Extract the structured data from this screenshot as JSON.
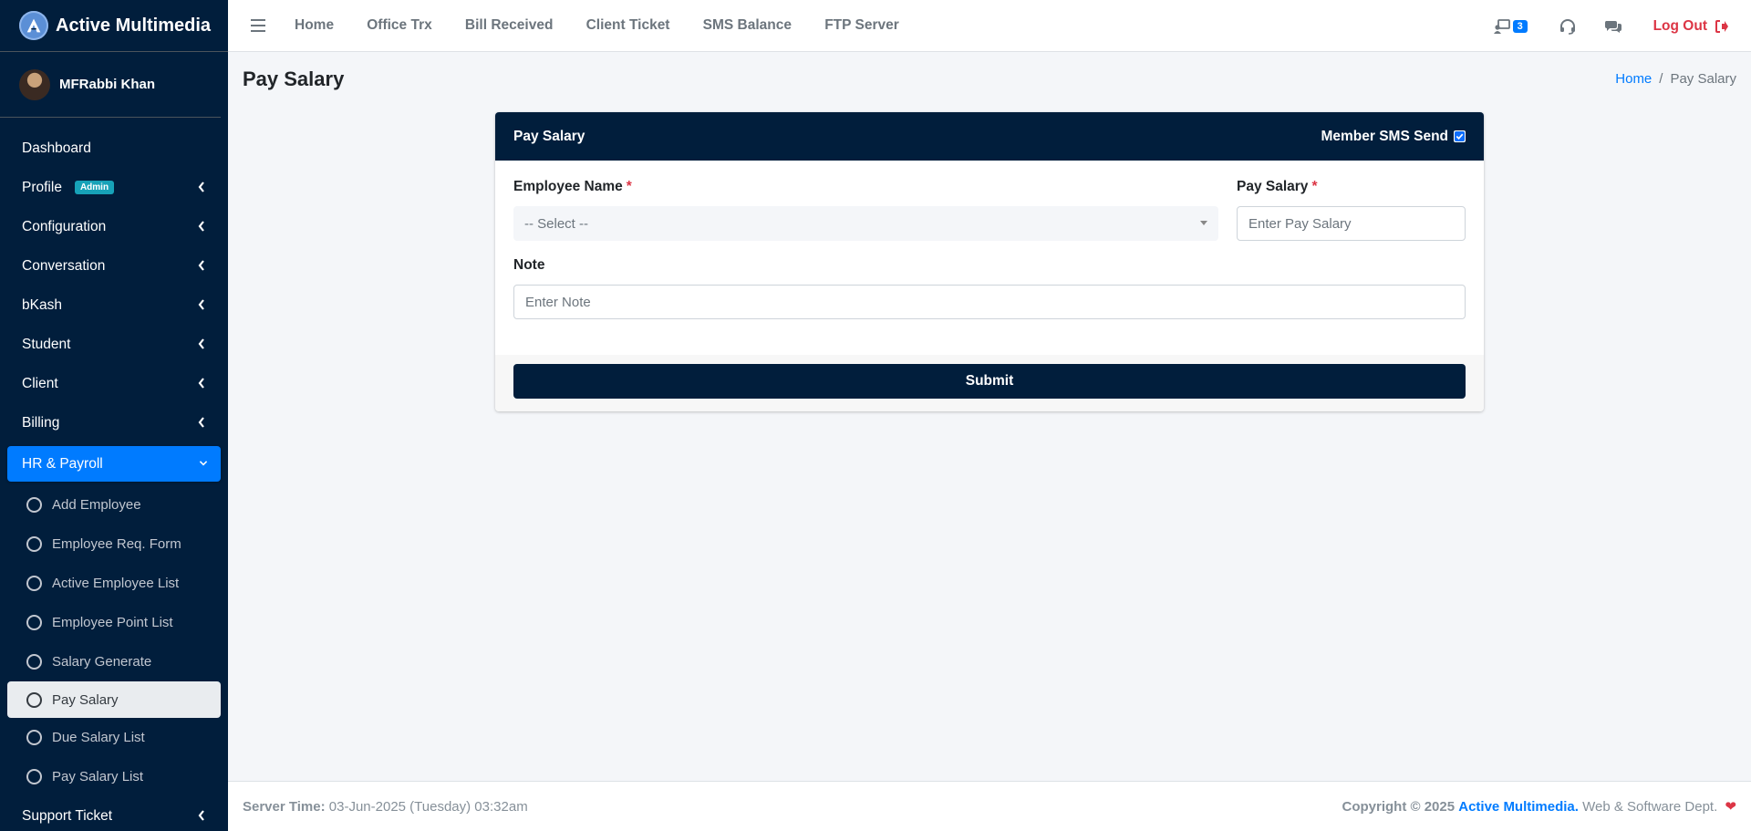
{
  "brand": {
    "name": "Active Multimedia"
  },
  "user": {
    "name": "MFRabbi Khan"
  },
  "sidebar": {
    "items": [
      {
        "label": "Dashboard"
      },
      {
        "label": "Profile",
        "badge": "Admin"
      },
      {
        "label": "Configuration"
      },
      {
        "label": "Conversation"
      },
      {
        "label": "bKash"
      },
      {
        "label": "Student"
      },
      {
        "label": "Client"
      },
      {
        "label": "Billing"
      },
      {
        "label": "HR & Payroll"
      },
      {
        "label": "Support Ticket"
      }
    ],
    "hr_sub": [
      {
        "label": "Add Employee"
      },
      {
        "label": "Employee Req. Form"
      },
      {
        "label": "Active Employee List"
      },
      {
        "label": "Employee Point List"
      },
      {
        "label": "Salary Generate"
      },
      {
        "label": "Pay Salary"
      },
      {
        "label": "Due Salary List"
      },
      {
        "label": "Pay Salary List"
      }
    ]
  },
  "topnav": {
    "links": [
      {
        "label": "Home"
      },
      {
        "label": "Office Trx"
      },
      {
        "label": "Bill Received"
      },
      {
        "label": "Client Ticket"
      },
      {
        "label": "SMS Balance"
      },
      {
        "label": "FTP Server"
      }
    ],
    "notification_count": "3",
    "logout_label": "Log Out"
  },
  "page": {
    "title": "Pay Salary",
    "breadcrumb_home": "Home",
    "breadcrumb_sep": "/",
    "breadcrumb_current": "Pay Salary"
  },
  "form": {
    "card_title": "Pay Salary",
    "sms_label": "Member SMS Send",
    "sms_checked": true,
    "employee_label": "Employee Name",
    "employee_select_value": "-- Select --",
    "pay_label": "Pay Salary",
    "pay_placeholder": "Enter Pay Salary",
    "note_label": "Note",
    "note_placeholder": "Enter Note",
    "required_mark": "*",
    "submit_label": "Submit"
  },
  "footer": {
    "server_label": "Server Time:",
    "server_value": "03-Jun-2025 (Tuesday) 03:32am",
    "copyright_prefix": "Copyright © 2025",
    "copyright_brand": "Active Multimedia.",
    "copyright_suffix": "Web & Software Dept."
  },
  "colors": {
    "sidebar_bg": "#011e3c",
    "accent": "#007bff",
    "danger": "#dc3545",
    "badge": "#17a2b8"
  }
}
